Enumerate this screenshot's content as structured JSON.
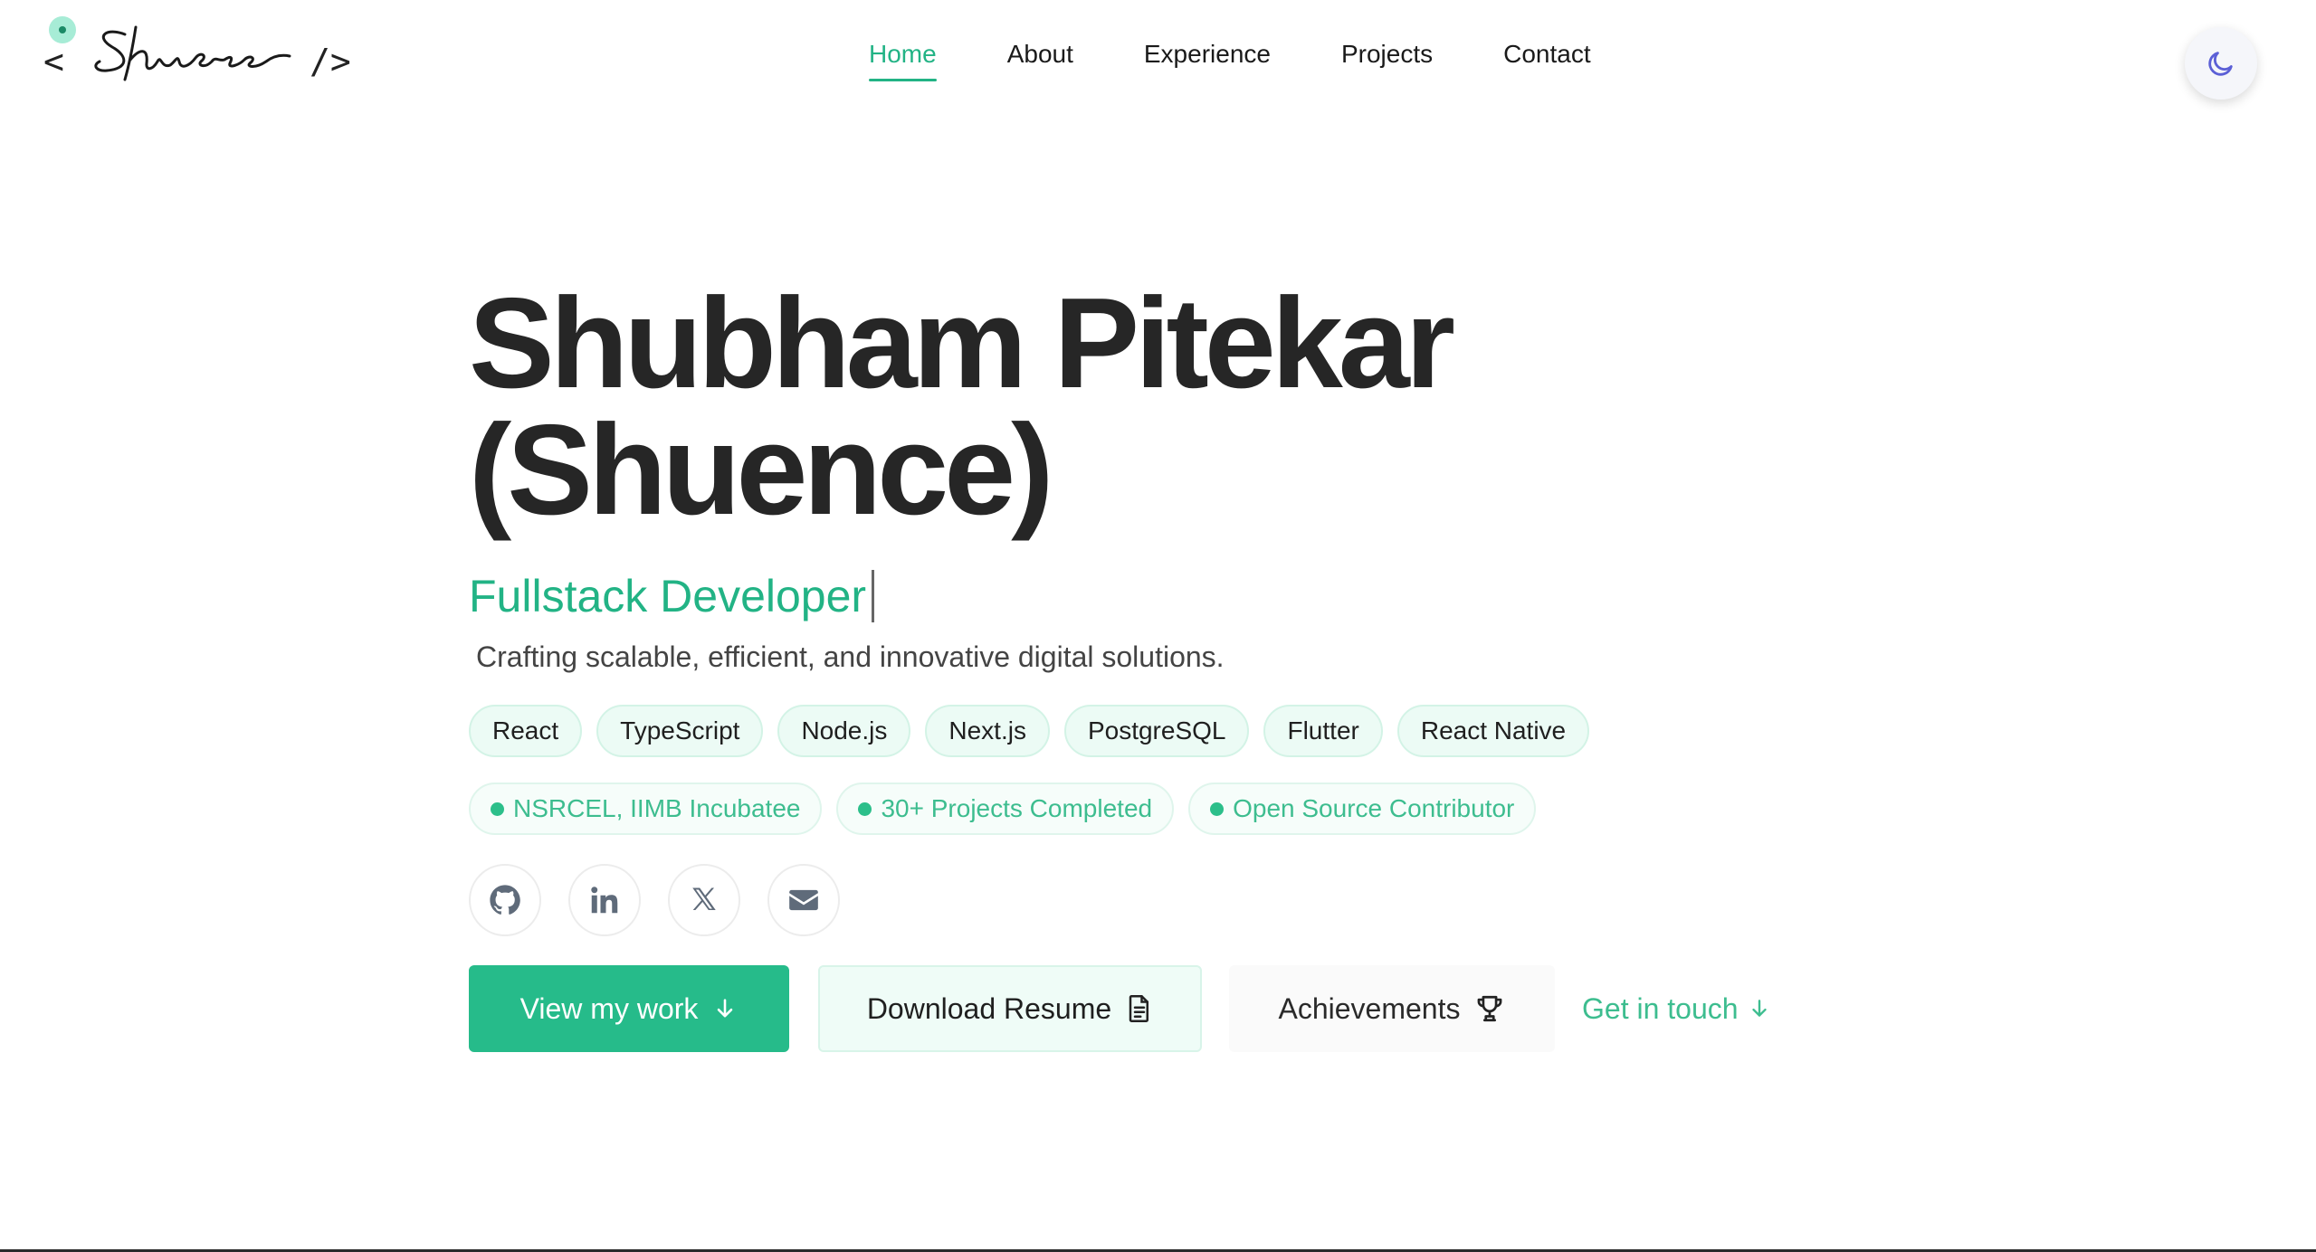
{
  "logo": {
    "open": "<",
    "signature": "Shuence",
    "close": "/>"
  },
  "nav": {
    "items": [
      {
        "label": "Home"
      },
      {
        "label": "About"
      },
      {
        "label": "Experience"
      },
      {
        "label": "Projects"
      },
      {
        "label": "Contact"
      }
    ],
    "active": "Home"
  },
  "theme_toggle": {
    "icon": "moon-icon"
  },
  "hero": {
    "name_line1": "Shubham Pitekar",
    "name_line2": "(Shuence)",
    "role": "Fullstack Developer",
    "tagline": "Crafting scalable, efficient, and innovative digital solutions."
  },
  "skills": [
    "React",
    "TypeScript",
    "Node.js",
    "Next.js",
    "PostgreSQL",
    "Flutter",
    "React Native"
  ],
  "badges": [
    "NSRCEL, IIMB Incubatee",
    "30+ Projects Completed",
    "Open Source Contributor"
  ],
  "socials": [
    {
      "icon": "github-icon"
    },
    {
      "icon": "linkedin-icon"
    },
    {
      "icon": "x-icon"
    },
    {
      "icon": "mail-icon"
    }
  ],
  "actions": {
    "view_work": "View my work",
    "download_resume": "Download Resume",
    "achievements": "Achievements",
    "get_in_touch": "Get in touch"
  },
  "colors": {
    "accent": "#22b385",
    "chip_bg": "#ecfbf5",
    "text": "#262626"
  }
}
